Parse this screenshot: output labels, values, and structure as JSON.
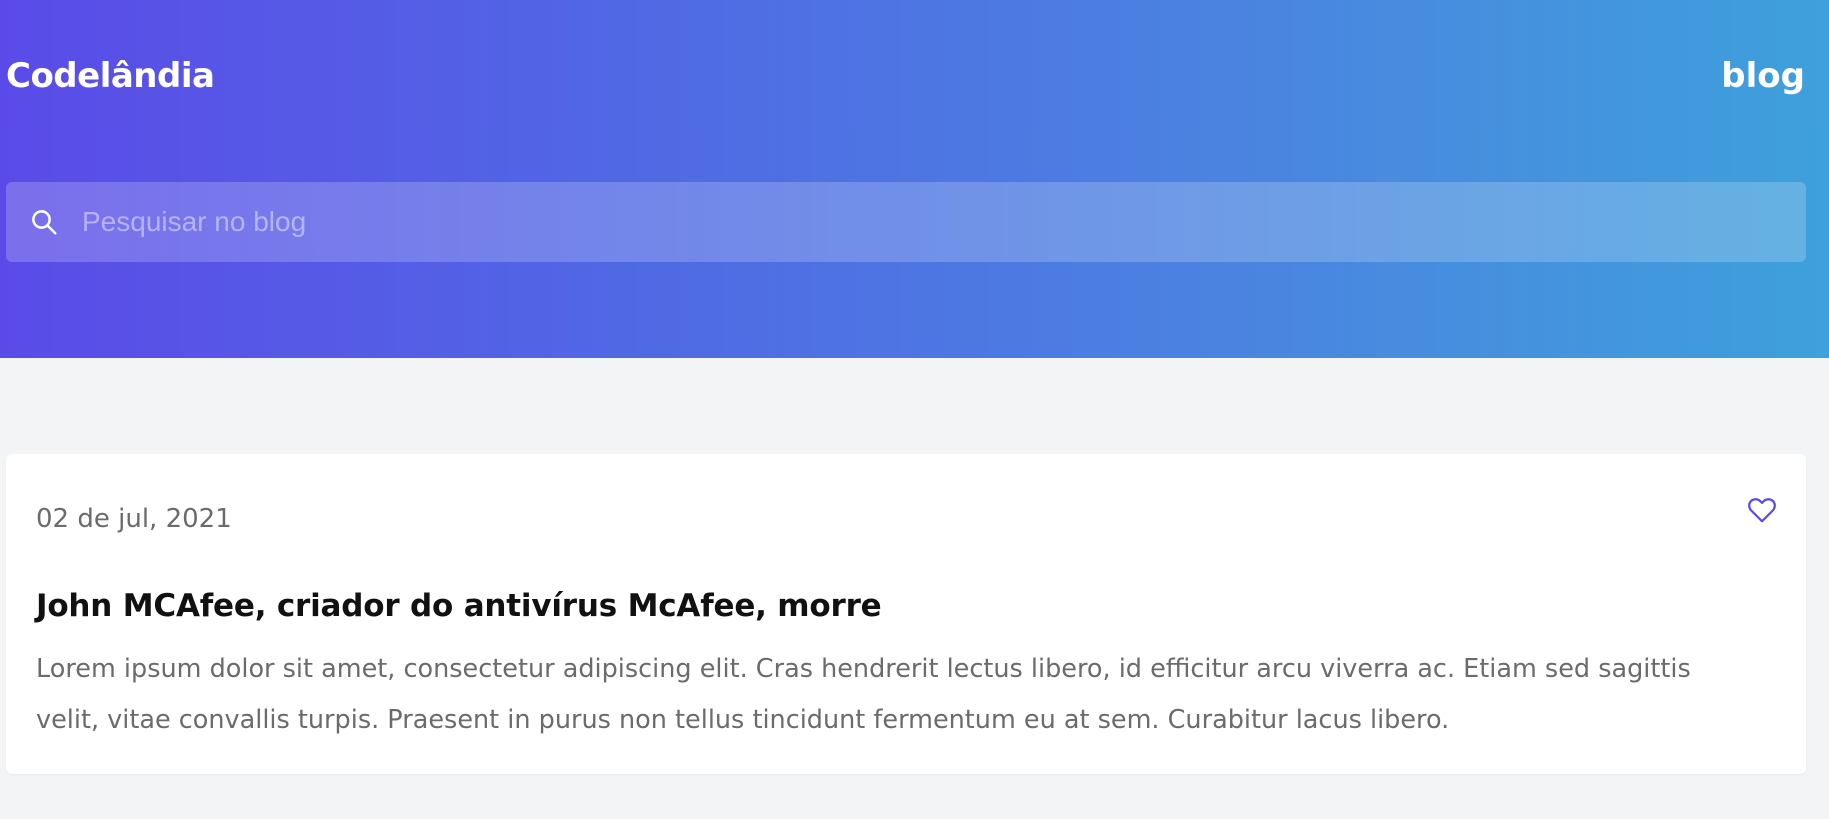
{
  "header": {
    "brand": "Codelândia",
    "nav_link": "blog"
  },
  "search": {
    "placeholder": "Pesquisar no blog",
    "value": "",
    "icon": "search-icon"
  },
  "post": {
    "date": "02 de jul, 2021",
    "title": "John MCAfee, criador do antivírus McAfee, morre",
    "excerpt": "Lorem ipsum dolor sit amet, consectetur adipiscing elit. Cras hendrerit lectus libero, id efficitur arcu viverra ac. Etiam sed sagittis velit, vitae convallis turpis. Praesent in purus non tellus tincidunt fermentum eu at sem. Curabitur lacus libero.",
    "like_icon": "heart-icon"
  },
  "colors": {
    "gradient_start": "#5a4be8",
    "gradient_end": "#3ea0dc",
    "accent": "#5a4be8",
    "page_background": "#f3f4f6"
  }
}
